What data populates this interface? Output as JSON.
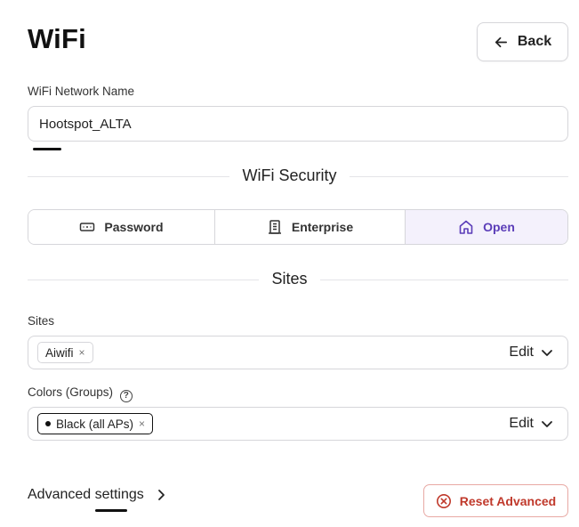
{
  "page": {
    "title": "WiFi",
    "back_label": "Back"
  },
  "network": {
    "label": "WiFi Network Name",
    "value": "Hootspot_ALTA"
  },
  "security": {
    "section_title": "WiFi Security",
    "options": [
      {
        "label": "Password",
        "icon": "keyboard-icon",
        "selected": false
      },
      {
        "label": "Enterprise",
        "icon": "building-icon",
        "selected": false
      },
      {
        "label": "Open",
        "icon": "home-icon",
        "selected": true
      }
    ],
    "accent_color": "#5b3db8"
  },
  "sites": {
    "section_title": "Sites",
    "label": "Sites",
    "chips": [
      "Aiwifi"
    ],
    "edit_label": "Edit"
  },
  "colors": {
    "label": "Colors (Groups)",
    "help": "?",
    "chips": [
      "Black (all APs)"
    ],
    "edit_label": "Edit"
  },
  "advanced": {
    "label": "Advanced settings",
    "reset_label": "Reset Advanced",
    "reset_color": "#c0392b"
  },
  "glyphs": {
    "chip_remove": "×"
  }
}
